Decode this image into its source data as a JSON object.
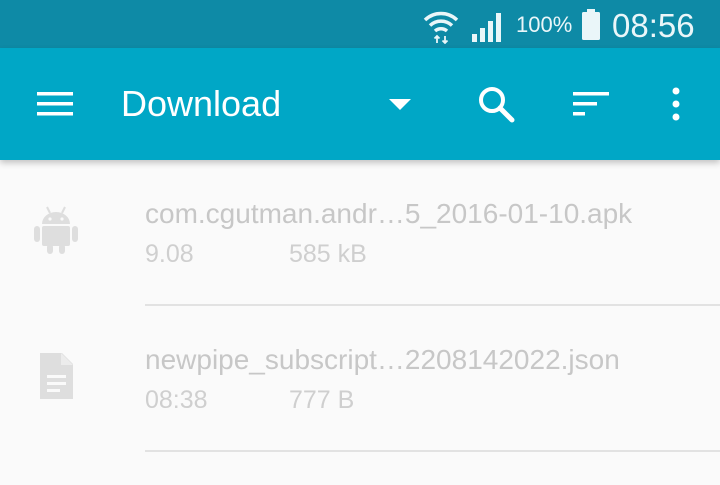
{
  "status_bar": {
    "battery_percent": "100%",
    "time": "08:56"
  },
  "toolbar": {
    "title": "Download"
  },
  "files": [
    {
      "name": "com.cgutman.andr…5_2016-01-10.apk",
      "date": "9.08",
      "size": "585 kB",
      "icon": "android-icon"
    },
    {
      "name": "newpipe_subscript…2208142022.json",
      "date": "08:38",
      "size": "777 B",
      "icon": "document-icon"
    }
  ],
  "colors": {
    "status_bar": "#0e8aa6",
    "toolbar": "#00a7c6",
    "background": "#fafafa",
    "muted_text": "#c7c7c7"
  }
}
